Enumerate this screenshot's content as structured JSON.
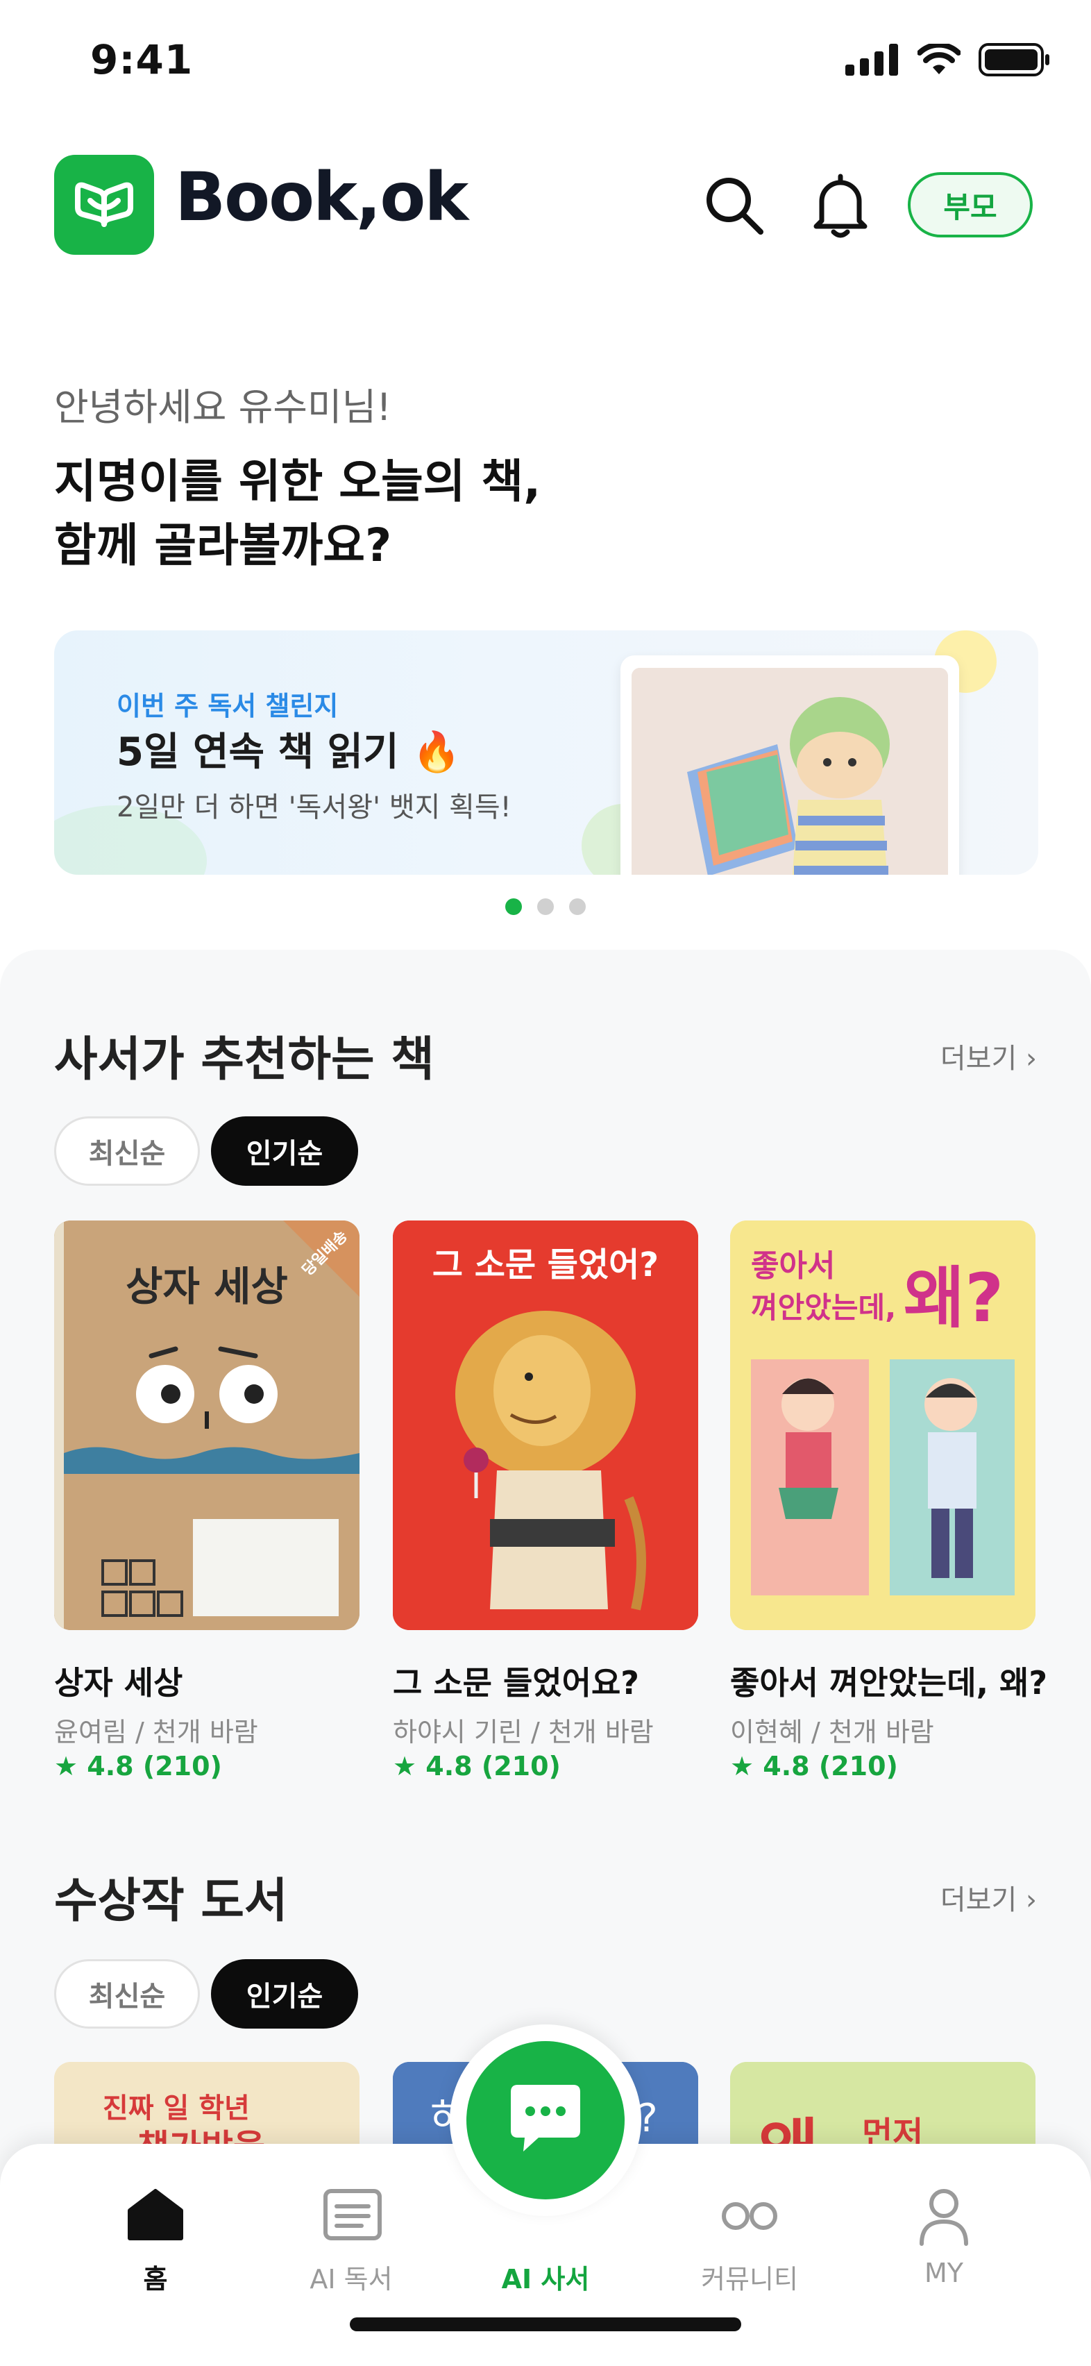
{
  "status_bar": {
    "time": "9:41"
  },
  "header": {
    "app_name": "Book,ok",
    "parent_button": "부모"
  },
  "greeting": {
    "subtitle": "안녕하세요 유수미님!",
    "title_line1": "지명이를 위한 오늘의 책,",
    "title_line2": "함께 골라볼까요?"
  },
  "banner": {
    "label": "이번 주 독서 챌린지",
    "title": "5일 연속 책 읽기 🔥",
    "description": "2일만 더 하면 '독서왕' 뱃지 획득!",
    "page_count": 3,
    "active_page": 1
  },
  "recommended": {
    "title": "사서가 추천하는 책",
    "more": "더보기 ›",
    "sort_options": [
      "최신순",
      "인기순"
    ],
    "selected_sort": "인기순",
    "books": [
      {
        "cover_title": "상자 세상",
        "cover_badge": "당일배송",
        "title": "상자 세상",
        "author": "윤여림 / 천개 바람",
        "rating": "★ 4.8 (210)"
      },
      {
        "cover_title": "그 소문 들었어?",
        "title": "그 소문 들었어요?",
        "author": "하야시 기린 / 천개 바람",
        "rating": "★ 4.8 (210)"
      },
      {
        "cover_title_line1": "좋아서",
        "cover_title_line2": "껴안았는데,",
        "cover_title_big": "왜?",
        "title": "좋아서 껴안았는데, 왜?",
        "author": "이현혜 / 천개 바람",
        "rating": "★ 4.8 (210)"
      }
    ]
  },
  "awards": {
    "title": "수상작 도서",
    "more": "더보기 ›",
    "sort_options": [
      "최신순",
      "인기순"
    ],
    "selected_sort": "인기순",
    "covers": [
      {
        "text_line1": "진짜 일 학년",
        "text_line2": "책가방을"
      },
      {
        "text_left": "하",
        "text_right": "?"
      },
      {
        "text_line1": "왜",
        "text_line2": "먼저"
      }
    ]
  },
  "bottom_nav": {
    "items": [
      {
        "label": "홈",
        "icon": "home-icon",
        "state": "active"
      },
      {
        "label": "AI 독서",
        "icon": "list-icon",
        "state": "inactive"
      },
      {
        "label": "AI 사서",
        "icon": "chat-bubble-icon",
        "state": "highlighted"
      },
      {
        "label": "커뮤니티",
        "icon": "community-icon",
        "state": "inactive"
      },
      {
        "label": "MY",
        "icon": "user-icon",
        "state": "inactive"
      }
    ]
  },
  "colors": {
    "brand_green": "#18b347",
    "rating_green": "#17a53f",
    "banner_label_blue": "#2a8ae6"
  }
}
